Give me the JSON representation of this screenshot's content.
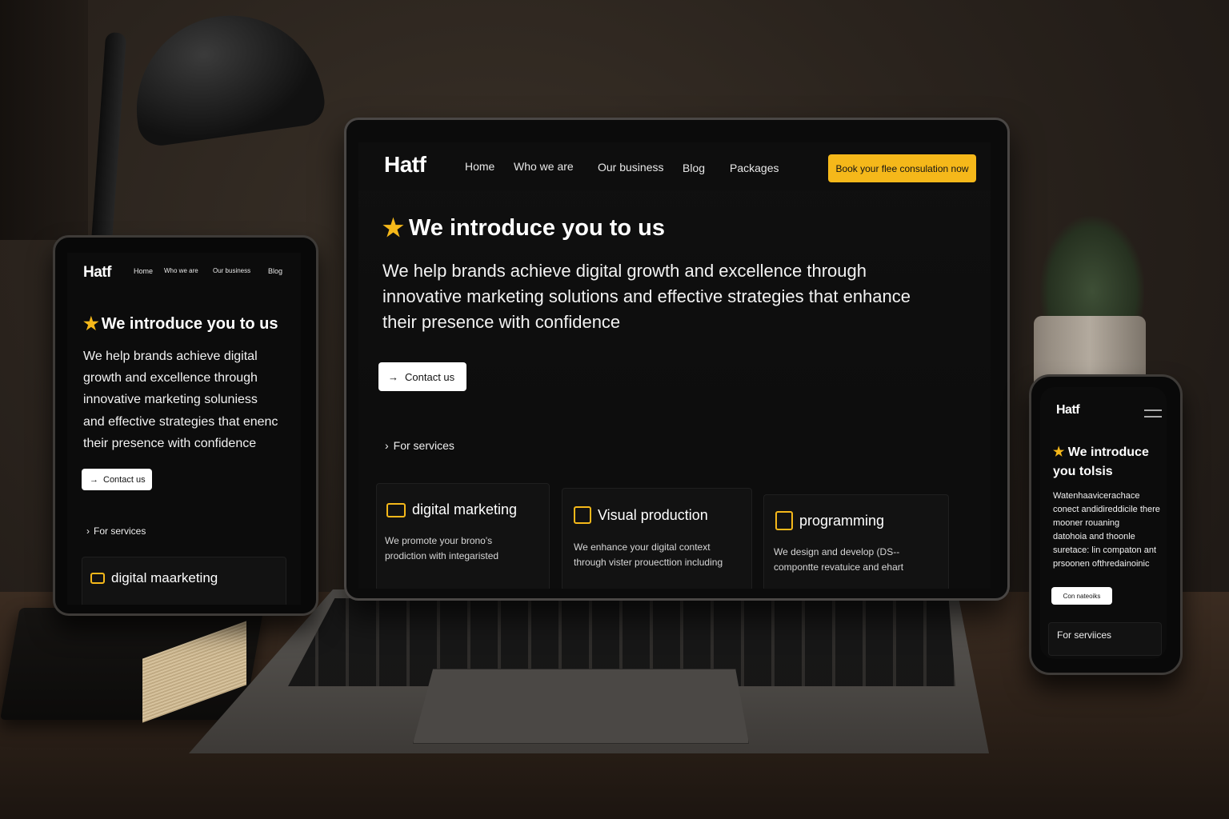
{
  "brand": {
    "logo": "Hatf",
    "accent_color": "#f5b81a",
    "background_color": "#0c0c0c"
  },
  "laptop": {
    "nav": {
      "items": [
        "Home",
        "Who we are",
        "Our business",
        "Blog",
        "Packages"
      ],
      "cta": "Book your flee consulation now"
    },
    "hero": {
      "star_icon": "star-icon",
      "title": "We introduce you to us",
      "lines": [
        "We help brands achieve digital growth and excellence through",
        "innovative marketing solutions and effective strategies that enhance",
        "their presence with confidence"
      ],
      "contact_label": "Contact us",
      "contact_icon": "arrow-right-icon"
    },
    "services": {
      "link_label": "For services",
      "cards": [
        {
          "icon": "laptop-icon",
          "title": "digital marketing",
          "lines": [
            "We promote your brono's",
            "prodiction with integaristed"
          ]
        },
        {
          "icon": "monitor-icon",
          "title": "Visual production",
          "lines": [
            "We enhance your digital context",
            "through vister prouecttion including"
          ]
        },
        {
          "icon": "code-icon",
          "title": "programming",
          "lines": [
            "We design and develop (DS--",
            "compontte revatuice and ehart"
          ]
        }
      ]
    }
  },
  "tablet": {
    "nav": {
      "items": [
        "Home",
        "Who we are",
        "Our business",
        "Blog"
      ]
    },
    "hero": {
      "title": "We introduce you to us",
      "lines": [
        "We help brands achieve digital",
        "growth and excellence through",
        "innovative marketing soluniess",
        "and effective strategies that enenc",
        "their presence with confidence"
      ],
      "contact_label": "Contact us"
    },
    "services": {
      "link_label": "For services",
      "card_title": "digital maarketing"
    }
  },
  "phone": {
    "hero": {
      "title_line1": "We introduce",
      "title_line2": "you tolsis",
      "lines": [
        "Watenhaavicerachace",
        "conect andidireddicile there",
        "mooner rouaning",
        "datohoia and thoonle",
        "suretace: lin compaton ant",
        "prsoonen ofthredainoinic"
      ],
      "contact_label": "Con nateoiks"
    },
    "services": {
      "link_label": "For serviices"
    }
  }
}
